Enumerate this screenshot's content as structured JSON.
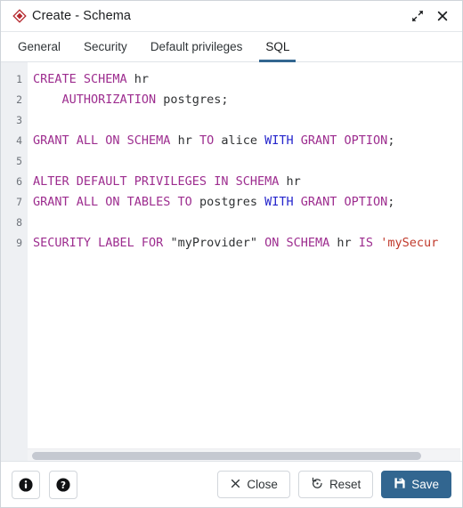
{
  "window": {
    "title": "Create - Schema",
    "icon": "schema-diamond-icon",
    "expand_icon": "expand-diagonal-icon",
    "close_icon": "close-x-icon",
    "accent_color": "#326690",
    "icon_color": "#b5272d"
  },
  "tabs": [
    {
      "label": "General",
      "active": false
    },
    {
      "label": "Security",
      "active": false
    },
    {
      "label": "Default privileges",
      "active": false
    },
    {
      "label": "SQL",
      "active": true
    }
  ],
  "editor": {
    "line_numbers": [
      "1",
      "2",
      "3",
      "4",
      "5",
      "6",
      "7",
      "8",
      "9"
    ],
    "lines": [
      {
        "n": "1",
        "text": "CREATE SCHEMA hr"
      },
      {
        "n": "2",
        "text": "    AUTHORIZATION postgres;"
      },
      {
        "n": "3",
        "text": ""
      },
      {
        "n": "4",
        "text": "GRANT ALL ON SCHEMA hr TO alice WITH GRANT OPTION;"
      },
      {
        "n": "5",
        "text": ""
      },
      {
        "n": "6",
        "text": "ALTER DEFAULT PRIVILEGES IN SCHEMA hr"
      },
      {
        "n": "7",
        "text": "GRANT ALL ON TABLES TO postgres WITH GRANT OPTION;"
      },
      {
        "n": "8",
        "text": ""
      },
      {
        "n": "9",
        "text": "SECURITY LABEL FOR \"myProvider\" ON SCHEMA hr IS 'mySecur"
      }
    ],
    "tokens": [
      [
        {
          "t": "CREATE SCHEMA",
          "c": "kw"
        },
        {
          "t": " hr",
          "c": "id"
        }
      ],
      [
        {
          "t": "    AUTHORIZATION",
          "c": "kw"
        },
        {
          "t": " postgres;",
          "c": "id"
        }
      ],
      [],
      [
        {
          "t": "GRANT ALL ON SCHEMA",
          "c": "kw"
        },
        {
          "t": " hr ",
          "c": "id"
        },
        {
          "t": "TO",
          "c": "kw"
        },
        {
          "t": " alice ",
          "c": "id"
        },
        {
          "t": "WITH",
          "c": "kw2"
        },
        {
          "t": " ",
          "c": "id"
        },
        {
          "t": "GRANT OPTION",
          "c": "kw"
        },
        {
          "t": ";",
          "c": "id"
        }
      ],
      [],
      [
        {
          "t": "ALTER DEFAULT PRIVILEGES IN SCHEMA",
          "c": "kw"
        },
        {
          "t": " hr",
          "c": "id"
        }
      ],
      [
        {
          "t": "GRANT ALL ON TABLES TO",
          "c": "kw"
        },
        {
          "t": " postgres ",
          "c": "id"
        },
        {
          "t": "WITH",
          "c": "kw2"
        },
        {
          "t": " ",
          "c": "id"
        },
        {
          "t": "GRANT OPTION",
          "c": "kw"
        },
        {
          "t": ";",
          "c": "id"
        }
      ],
      [],
      [
        {
          "t": "SECURITY LABEL FOR",
          "c": "kw"
        },
        {
          "t": " \"myProvider\" ",
          "c": "id"
        },
        {
          "t": "ON SCHEMA",
          "c": "kw"
        },
        {
          "t": " hr ",
          "c": "id"
        },
        {
          "t": "IS",
          "c": "kw"
        },
        {
          "t": " ",
          "c": "id"
        },
        {
          "t": "'mySecur",
          "c": "str"
        }
      ]
    ],
    "scrollbar": {
      "orientation": "horizontal",
      "name": "sql-horizontal-scrollbar"
    }
  },
  "footer": {
    "info_icon": "info-circle-icon",
    "help_icon": "help-circle-icon",
    "close_label": "Close",
    "close_icon": "close-x-icon",
    "reset_label": "Reset",
    "reset_icon": "reset-circular-arrow-icon",
    "save_label": "Save",
    "save_icon": "save-floppy-icon"
  }
}
